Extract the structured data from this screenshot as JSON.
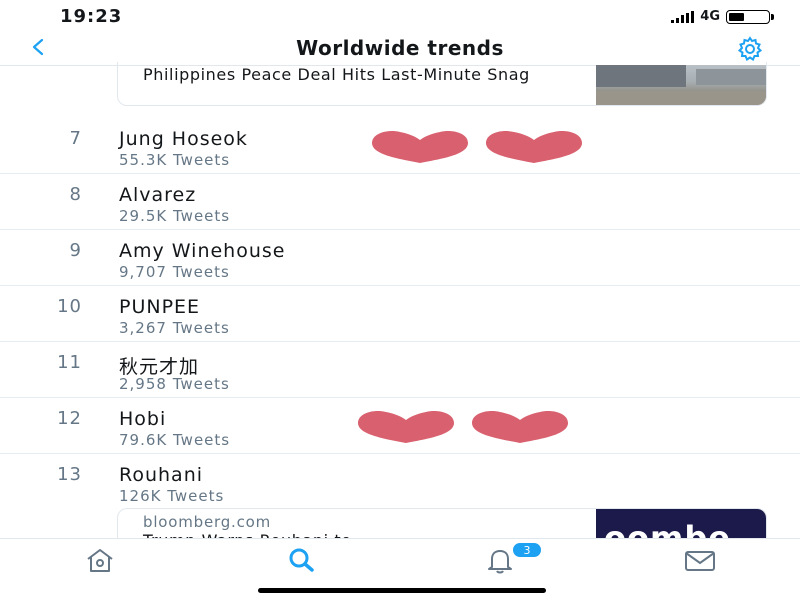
{
  "status_bar": {
    "time": "19:23",
    "network": "4G",
    "battery_level": 0.4
  },
  "nav": {
    "back_icon": "chevron-left-icon",
    "title": "Worldwide trends",
    "settings_icon": "gear-icon",
    "accent_color": "#1da1f2"
  },
  "top_news": {
    "title": "Philippines Peace Deal Hits Last-Minute Snag"
  },
  "trends": [
    {
      "rank": "7",
      "name": "Jung Hoseok",
      "tweets": "55.3K Tweets"
    },
    {
      "rank": "8",
      "name": "Alvarez",
      "tweets": "29.5K Tweets"
    },
    {
      "rank": "9",
      "name": "Amy Winehouse",
      "tweets": "9,707 Tweets"
    },
    {
      "rank": "10",
      "name": "PUNPEE",
      "tweets": "3,267 Tweets"
    },
    {
      "rank": "11",
      "name": "秋元才加",
      "tweets": "2,958 Tweets"
    },
    {
      "rank": "12",
      "name": "Hobi",
      "tweets": "79.6K Tweets"
    },
    {
      "rank": "13",
      "name": "Rouhani",
      "tweets": "126K Tweets"
    }
  ],
  "bottom_news": {
    "source": "bloomberg.com",
    "title": "Trump Warns Rouhani to",
    "thumb_text": "oombe"
  },
  "tabs": {
    "items": [
      "home-icon",
      "search-icon",
      "notifications-icon",
      "messages-icon"
    ],
    "notifications_badge": "3",
    "active": "search-icon"
  },
  "colors": {
    "heart": "#d9606e",
    "secondary_text": "#657786"
  }
}
